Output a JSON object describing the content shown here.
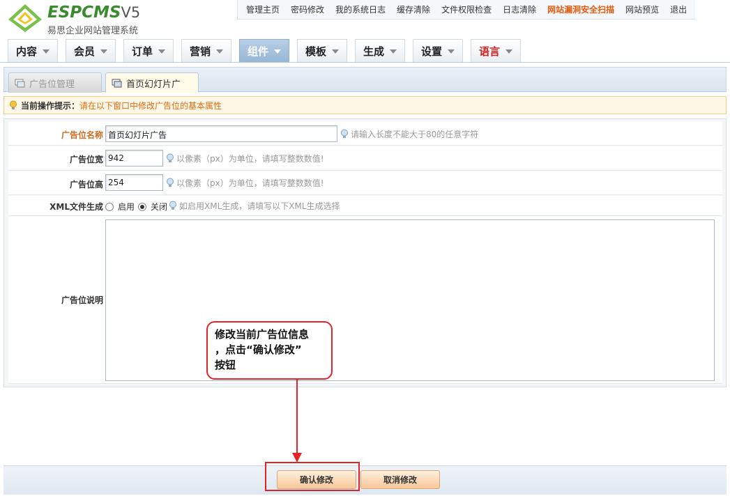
{
  "app": {
    "logo_text": "ESPCMS",
    "logo_version": "V5",
    "logo_subtitle": "易思企业网站管理系统"
  },
  "topnav": {
    "items": [
      "管理主页",
      "密码修改",
      "我的系统日志",
      "缓存清除",
      "文件权限检查",
      "日志清除",
      "网站漏洞安全扫描",
      "网站预览",
      "退出"
    ]
  },
  "mainmenu": {
    "items": [
      "内容",
      "会员",
      "订单",
      "营销",
      "组件",
      "模板",
      "生成",
      "设置",
      "语言"
    ],
    "active": "组件"
  },
  "tabs": {
    "items": [
      "广告位管理",
      "首页幻灯片广"
    ]
  },
  "tip": {
    "label": "当前操作提示：",
    "message": "请在以下窗口中修改广告位的基本属性"
  },
  "form": {
    "name_label": "广告位名称",
    "name_value": "首页幻灯片广告",
    "name_hint": "请输入长度不能大于80的任意字符",
    "width_label": "广告位宽",
    "width_value": "942",
    "width_hint": "以像素（px）为单位，请填写整数数值!",
    "height_label": "广告位高",
    "height_value": "254",
    "height_hint": "以像素（px）为单位，请填写整数数值!",
    "xml_label": "XML文件生成",
    "xml_on": "启用",
    "xml_off": "关闭",
    "xml_selected": "关闭",
    "xml_hint": "如启用XML生成，请填写以下XML生成选择",
    "desc_label": "广告位说明",
    "desc_value": ""
  },
  "callout": {
    "line1": "修改当前广告位信息",
    "line2": "，点击“确认修改”",
    "line3": "按钮"
  },
  "buttons": {
    "confirm": "确认修改",
    "cancel": "取消修改"
  }
}
